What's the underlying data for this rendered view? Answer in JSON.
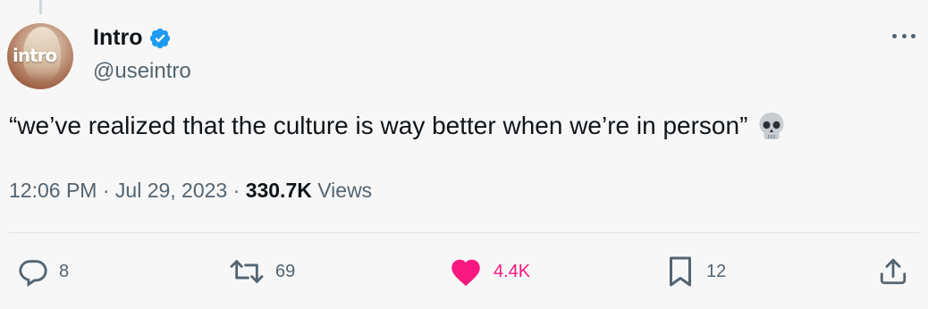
{
  "author": {
    "display_name": "Intro",
    "handle": "@useintro",
    "avatar_logo_text": "intro",
    "verified": true
  },
  "tweet": {
    "text": "“we’ve realized that the culture is way better when we’re in person”",
    "emoji": "skull"
  },
  "meta": {
    "time": "12:06 PM",
    "separator": " · ",
    "date": "Jul 29, 2023",
    "views_count": "330.7K",
    "views_label": " Views"
  },
  "actions": {
    "replies": "8",
    "reposts": "69",
    "likes": "4.4K",
    "bookmarks": "12"
  },
  "colors": {
    "background": "#f7f7f7",
    "text_primary": "#0f1419",
    "text_secondary": "#536471",
    "verified_blue": "#1d9bf0",
    "like_pink": "#f91880"
  },
  "icons": [
    "verified-badge-icon",
    "more-options-icon",
    "skull-emoji-icon",
    "reply-icon",
    "repost-icon",
    "heart-icon",
    "bookmark-icon",
    "share-icon"
  ]
}
